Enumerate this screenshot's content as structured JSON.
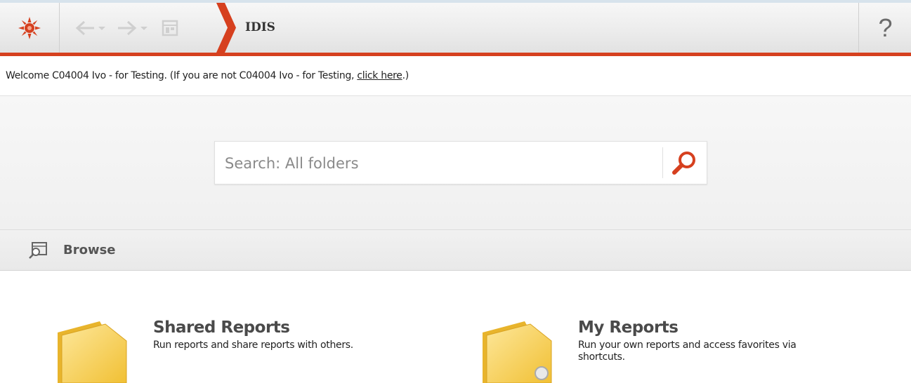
{
  "toolbar": {
    "logo_icon": "sun-logo-icon",
    "back_icon": "back-arrow-icon",
    "forward_icon": "forward-arrow-icon",
    "page_icon": "page-icon",
    "breadcrumb": "IDIS",
    "help_label": "?",
    "accent_color": "#d6401f"
  },
  "welcome": {
    "prefix": "Welcome C04004 Ivo - for Testing. (If you are not C04004 Ivo - for Testing, ",
    "link": "click here",
    "suffix": ".)"
  },
  "search": {
    "placeholder": "Search: All folders",
    "button_icon": "magnifier-icon"
  },
  "browse": {
    "label": "Browse",
    "icon": "browse-icon"
  },
  "cards": [
    {
      "title": "Shared Reports",
      "description": "Run reports and share reports with others.",
      "icon": "folder-icon"
    },
    {
      "title": "My Reports",
      "description": "Run your own reports and access favorites via shortcuts.",
      "icon": "folder-icon"
    }
  ]
}
